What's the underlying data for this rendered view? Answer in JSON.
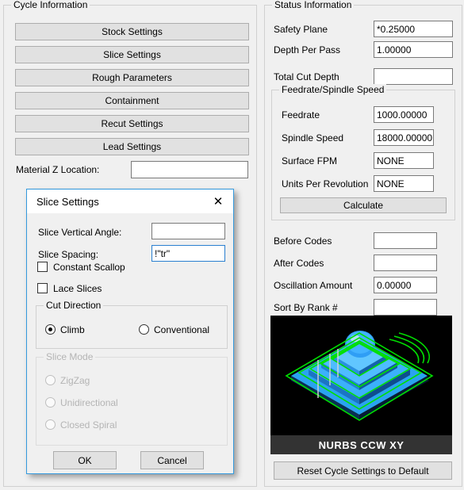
{
  "cycle_info": {
    "title": "Cycle Information",
    "buttons": [
      {
        "label": "Stock Settings"
      },
      {
        "label": "Slice Settings"
      },
      {
        "label": "Rough Parameters"
      },
      {
        "label": "Containment"
      },
      {
        "label": "Recut Settings"
      },
      {
        "label": "Lead Settings"
      }
    ],
    "material_z": {
      "label": "Material Z Location:",
      "value": ""
    }
  },
  "status_info": {
    "title": "Status Information",
    "fields": [
      {
        "label": "Safety Plane",
        "value": "*0.25000"
      },
      {
        "label": "Depth Per Pass",
        "value": "1.00000"
      },
      {
        "label": "Total Cut Depth",
        "value": ""
      }
    ],
    "feed_group": {
      "title": "Feedrate/Spindle Speed",
      "fields": [
        {
          "label": "Feedrate",
          "value": "1000.00000"
        },
        {
          "label": "Spindle Speed",
          "value": "18000.00000"
        },
        {
          "label": "Surface FPM",
          "value": "NONE"
        },
        {
          "label": "Units Per Revolution",
          "value": "NONE"
        }
      ],
      "calculate_label": "Calculate"
    },
    "lower_fields": [
      {
        "label": "Before Codes",
        "value": ""
      },
      {
        "label": "After Codes",
        "value": ""
      },
      {
        "label": "Oscillation Amount",
        "value": "0.00000"
      },
      {
        "label": "Sort By Rank #",
        "value": ""
      }
    ],
    "preview": {
      "caption": "NURBS CCW XY"
    },
    "reset_label": "Reset Cycle Settings to Default"
  },
  "dialog": {
    "title": "Slice Settings",
    "close_icon": "close-icon",
    "fields": [
      {
        "label": "Slice Vertical Angle:",
        "value": ""
      },
      {
        "label": "Slice Spacing:",
        "value": "!\"tr\""
      }
    ],
    "checkboxes": [
      {
        "label": "Constant Scallop",
        "checked": false
      },
      {
        "label": "Lace Slices",
        "checked": false
      }
    ],
    "cut_direction": {
      "title": "Cut Direction",
      "options": [
        {
          "label": "Climb",
          "selected": true
        },
        {
          "label": "Conventional",
          "selected": false
        }
      ]
    },
    "slice_mode": {
      "title": "Slice Mode",
      "disabled": true,
      "options": [
        {
          "label": "ZigZag",
          "selected": false
        },
        {
          "label": "Unidirectional",
          "selected": false
        },
        {
          "label": "Closed Spiral",
          "selected": false
        }
      ]
    },
    "ok_label": "OK",
    "cancel_label": "Cancel"
  },
  "colors": {
    "background": "#f0f0f0",
    "button_face": "#e1e1e1",
    "dialog_accent": "#3399dd",
    "preview_bg": "#000000",
    "toolpath_green": "#00e000",
    "model_blue": "#1e90ff"
  }
}
